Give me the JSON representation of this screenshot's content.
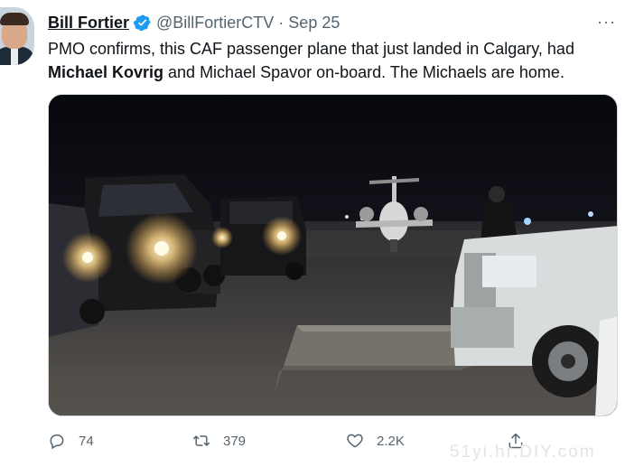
{
  "author": {
    "name": "Bill Fortier",
    "handle": "@BillFortierCTV",
    "separator": "·",
    "date": "Sep 25"
  },
  "icons": {
    "verified": "verified-badge-icon",
    "more": "more-horizontal-icon",
    "reply": "reply-icon",
    "retweet": "retweet-icon",
    "like": "heart-icon",
    "share": "share-icon"
  },
  "more_label": "···",
  "tweet": {
    "part1": "PMO confirms, this CAF passenger plane that just landed in Calgary, had ",
    "bold": "Michael Kovrig",
    "part2": " and Michael Spavor on-board. The Michaels are home."
  },
  "actions": {
    "replies": "74",
    "retweets": "379",
    "likes": "2.2K"
  },
  "watermark": "51yi.hr.DIY.com",
  "colors": {
    "text": "#0f1419",
    "secondary": "#536471",
    "verified": "#1d9bf0",
    "border": "#cfd9de"
  }
}
